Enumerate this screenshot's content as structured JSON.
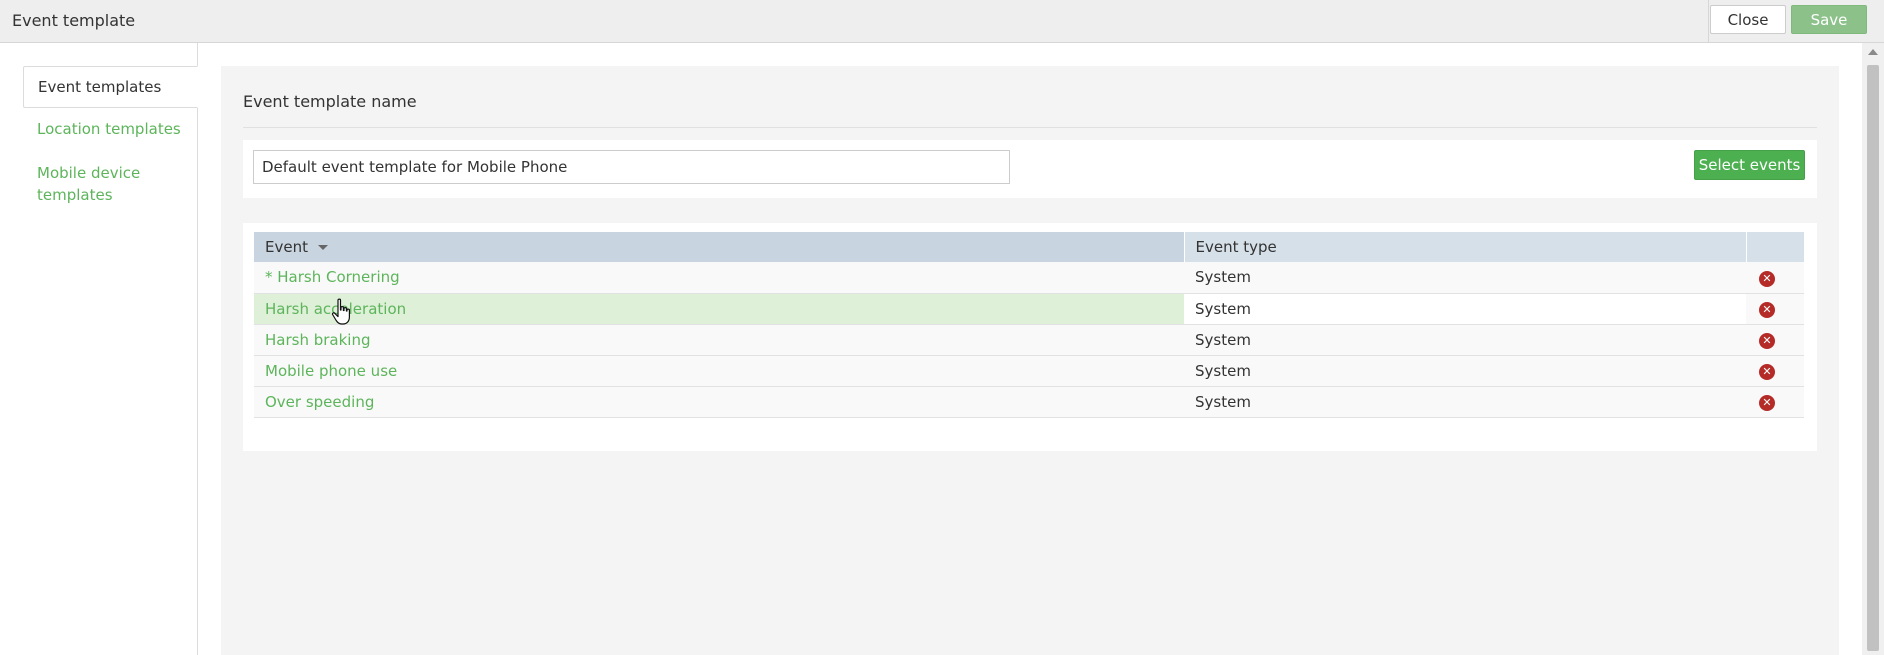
{
  "window": {
    "title": "Event template",
    "close_label": "Close",
    "save_label": "Save"
  },
  "sidebar": {
    "items": [
      {
        "label": "Event templates",
        "active": true
      },
      {
        "label": "Location templates",
        "active": false
      },
      {
        "label": "Mobile device templates",
        "active": false
      }
    ]
  },
  "main": {
    "section_title": "Event template name",
    "template_name_value": "Default event template for Mobile Phone",
    "select_events_label": "Select events",
    "table": {
      "headers": [
        "Event",
        "Event type"
      ],
      "sort_column": "Event",
      "rows": [
        {
          "event": "* Harsh Cornering",
          "type": "System"
        },
        {
          "event": "Harsh acceleration",
          "type": "System"
        },
        {
          "event": "Harsh braking",
          "type": "System"
        },
        {
          "event": "Mobile phone use",
          "type": "System"
        },
        {
          "event": "Over speeding",
          "type": "System"
        }
      ],
      "delete_icon": "remove-circle-icon"
    }
  },
  "colors": {
    "accent_green": "#4caf50",
    "link_green": "#5db55b",
    "delete_red": "#b52b27",
    "header_blue": "#c8d4df"
  }
}
